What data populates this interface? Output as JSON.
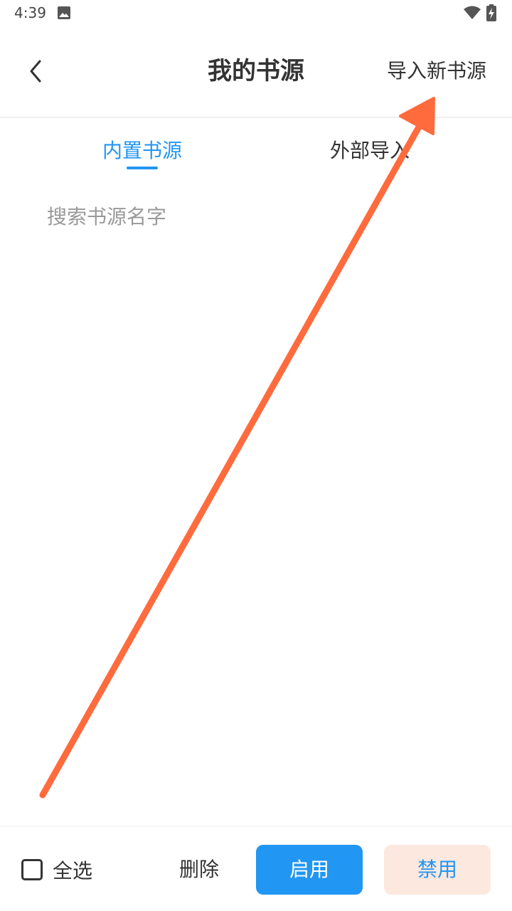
{
  "status_bar": {
    "time": "4:39",
    "icons": [
      "gallery-icon",
      "wifi-icon",
      "battery-charging-icon"
    ]
  },
  "header": {
    "back_icon": "chevron-left-icon",
    "title": "我的书源",
    "import_label": "导入新书源"
  },
  "tabs": [
    {
      "label": "内置书源",
      "selected": true
    },
    {
      "label": "外部导入",
      "selected": false
    }
  ],
  "search": {
    "placeholder": "搜索书源名字",
    "value": ""
  },
  "bottom_bar": {
    "select_all_label": "全选",
    "select_all_checked": false,
    "delete_label": "删除",
    "enable_label": "启用",
    "disable_label": "禁用"
  },
  "colors": {
    "accent": "#2196f3",
    "text": "#333333",
    "placeholder": "#999999",
    "disable_bg": "#fde8e0",
    "annotation_arrow": "#ff6b3d"
  }
}
